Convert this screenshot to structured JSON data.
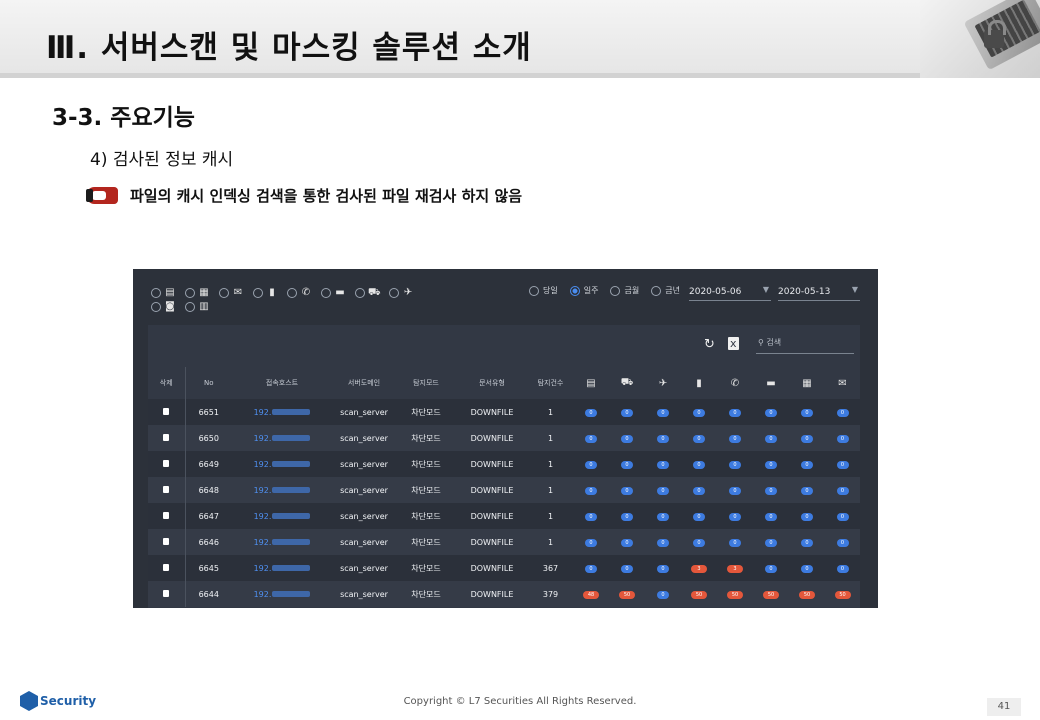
{
  "slide": {
    "header_title": "Ⅲ. 서버스캔 및 마스킹 솔루션 소개",
    "section_title": "3-3. 주요기능",
    "sub_title": "4) 검사된 정보 캐시",
    "bullet_text": "파일의 캐시 인덱싱 검색을 통한 검사된 파일 재검사 하지 않음",
    "bullet_icon": "pointing-hand-icon",
    "header_image_icon": "laptop-lock-icon"
  },
  "app": {
    "filter_icons": [
      "doc-card-icon",
      "building-icon",
      "envelope-icon",
      "phone-icon",
      "call-icon",
      "card-icon",
      "car-icon",
      "airplane-icon",
      "camera-icon",
      "grid-doc-icon"
    ],
    "periods": [
      {
        "label": "당일",
        "selected": false
      },
      {
        "label": "일주",
        "selected": true
      },
      {
        "label": "금월",
        "selected": false
      },
      {
        "label": "금년",
        "selected": false
      }
    ],
    "date_from": "2020-05-06",
    "date_to": "2020-05-13",
    "search_placeholder": "검색",
    "toolbar_icons": [
      "refresh-icon",
      "excel-export-icon"
    ],
    "columns": [
      "삭제",
      "No",
      "접속호스트",
      "서버도메인",
      "탐지모드",
      "문서유형",
      "탐지건수"
    ],
    "icon_columns": [
      "doc-card-icon",
      "car-icon",
      "airplane-icon",
      "phone-icon",
      "call-icon",
      "card-icon",
      "building-icon",
      "envelope-icon"
    ],
    "rows": [
      {
        "no": "6651",
        "host": "192.",
        "domain": "scan_server",
        "mode": "차단모드",
        "type": "DOWNFILE",
        "count": "1",
        "flags": [
          "0",
          "0",
          "0",
          "0",
          "0",
          "0",
          "0",
          "0"
        ]
      },
      {
        "no": "6650",
        "host": "192.",
        "domain": "scan_server",
        "mode": "차단모드",
        "type": "DOWNFILE",
        "count": "1",
        "flags": [
          "0",
          "0",
          "0",
          "0",
          "0",
          "0",
          "0",
          "0"
        ]
      },
      {
        "no": "6649",
        "host": "192.",
        "domain": "scan_server",
        "mode": "차단모드",
        "type": "DOWNFILE",
        "count": "1",
        "flags": [
          "0",
          "0",
          "0",
          "0",
          "0",
          "0",
          "0",
          "0"
        ]
      },
      {
        "no": "6648",
        "host": "192.",
        "domain": "scan_server",
        "mode": "차단모드",
        "type": "DOWNFILE",
        "count": "1",
        "flags": [
          "0",
          "0",
          "0",
          "0",
          "0",
          "0",
          "0",
          "0"
        ]
      },
      {
        "no": "6647",
        "host": "192.",
        "domain": "scan_server",
        "mode": "차단모드",
        "type": "DOWNFILE",
        "count": "1",
        "flags": [
          "0",
          "0",
          "0",
          "0",
          "0",
          "0",
          "0",
          "0"
        ]
      },
      {
        "no": "6646",
        "host": "192.",
        "domain": "scan_server",
        "mode": "차단모드",
        "type": "DOWNFILE",
        "count": "1",
        "flags": [
          "0",
          "0",
          "0",
          "0",
          "0",
          "0",
          "0",
          "0"
        ]
      },
      {
        "no": "6645",
        "host": "192.",
        "domain": "scan_server",
        "mode": "차단모드",
        "type": "DOWNFILE",
        "count": "367",
        "flags": [
          "0",
          "0",
          "0",
          "3",
          "3",
          "0",
          "0",
          "0"
        ]
      },
      {
        "no": "6644",
        "host": "192.",
        "domain": "scan_server",
        "mode": "차단모드",
        "type": "DOWNFILE",
        "count": "379",
        "flags": [
          "48",
          "50",
          "0",
          "50",
          "50",
          "50",
          "50",
          "50"
        ]
      }
    ]
  },
  "footer": {
    "logo_text": "Security",
    "copyright": "Copyright © L7 Securities All Rights Reserved.",
    "page_number": "41"
  },
  "colors": {
    "app_background": "#2c313a",
    "accent_blue": "#3d7be0",
    "alert_red": "#e4573b",
    "brand_blue": "#1f5fa8"
  }
}
